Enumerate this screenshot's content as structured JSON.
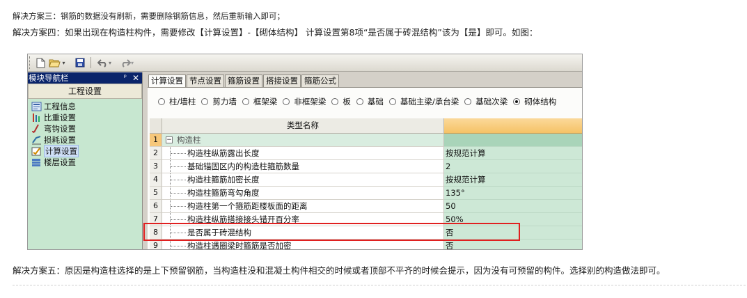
{
  "article": {
    "solution3": "解决方案三：钢筋的数据没有刷新，需要删除钢筋信息，然后重新输入即可；",
    "solution4": "解决方案四：如果出现在构造柱构件，需要修改【计算设置】-【砌体结构】 计算设置第8项“是否属于砖混结构”该为【是】即可。如图：",
    "solution5": "解决方案五：原因是构造柱选择的是上下预留钢筋，当构造柱没和混凝土构件相交的时候或者顶部不平齐的时候会提示，因为没有可预留的构件。选择别的构造做法即可。"
  },
  "toolbar": {
    "new_icon": "new-file-icon",
    "open_icon": "open-folder-icon",
    "save_icon": "save-disk-icon",
    "undo_icon": "undo-icon",
    "redo_icon": "redo-icon"
  },
  "nav": {
    "title": "模块导航栏",
    "pin_glyph": "ᵖ",
    "close_glyph": "✕",
    "group": "工程设置",
    "items": [
      {
        "label": "工程信息",
        "icon": "info-icon"
      },
      {
        "label": "比重设置",
        "icon": "weight-icon"
      },
      {
        "label": "弯钩设置",
        "icon": "hook-icon"
      },
      {
        "label": "损耗设置",
        "icon": "loss-icon"
      },
      {
        "label": "计算设置",
        "icon": "calc-icon",
        "selected": true
      },
      {
        "label": "楼层设置",
        "icon": "floors-icon"
      }
    ]
  },
  "tabs": [
    "计算设置",
    "节点设置",
    "箍筋设置",
    "搭接设置",
    "箍筋公式"
  ],
  "radios": [
    {
      "label": "柱/墙柱",
      "checked": false
    },
    {
      "label": "剪力墙",
      "checked": false
    },
    {
      "label": "框架梁",
      "checked": false
    },
    {
      "label": "非框架梁",
      "checked": false
    },
    {
      "label": "板",
      "checked": false
    },
    {
      "label": "基础",
      "checked": false
    },
    {
      "label": "基础主梁/承台梁",
      "checked": false
    },
    {
      "label": "基础次梁",
      "checked": false
    },
    {
      "label": "砌体结构",
      "checked": true
    }
  ],
  "grid": {
    "header_name": "类型名称",
    "group": {
      "num": "1",
      "expander": "−",
      "label": "构造柱"
    },
    "rows": [
      {
        "num": "2",
        "name": "构造柱纵筋露出长度",
        "value": "按规范计算"
      },
      {
        "num": "3",
        "name": "基础锚固区内的构造柱箍筋数量",
        "value": "2"
      },
      {
        "num": "4",
        "name": "构造柱箍筋加密长度",
        "value": "按规范计算"
      },
      {
        "num": "5",
        "name": "构造柱箍筋弯勾角度",
        "value": "135°"
      },
      {
        "num": "6",
        "name": "构造柱第一个箍筋距楼板面的距离",
        "value": "50"
      },
      {
        "num": "7",
        "name": "构造柱纵筋搭接接头错开百分率",
        "value": "50%"
      },
      {
        "num": "8",
        "name": "是否属于砖混结构",
        "value": "否",
        "highlighted": true
      },
      {
        "num": "9",
        "name": "构造柱遇圈梁时箍筋是否加密",
        "value": "否"
      }
    ]
  },
  "colors": {
    "highlight_box": "#e02020",
    "value_column": "#cde8d6",
    "header_value": "#f5c266",
    "nav_title": "#0a246a"
  }
}
